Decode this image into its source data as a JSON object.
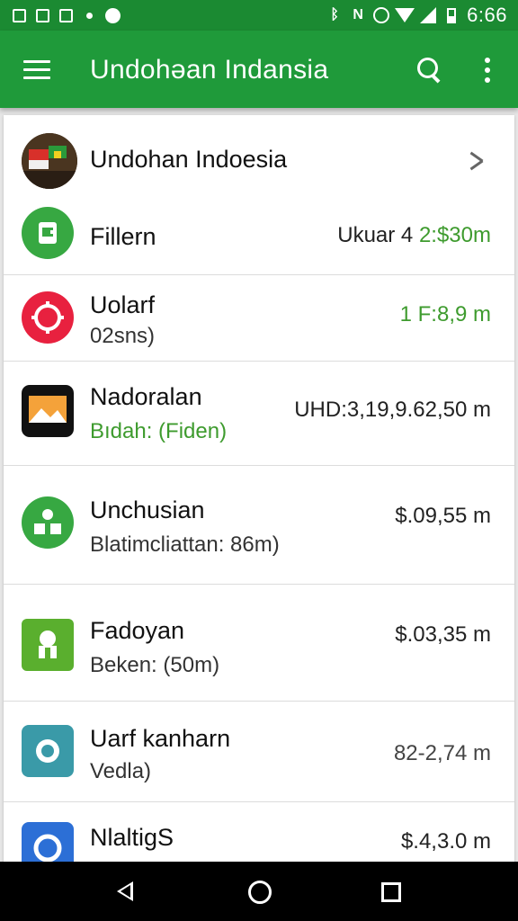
{
  "status_bar": {
    "time": "6:66",
    "icons": [
      "sim-icon",
      "sim-icon",
      "notification-icon",
      "dot-icon",
      "alarm-icon",
      "bluetooth-icon",
      "nfc-icon",
      "alarm-clock-icon",
      "wifi-icon",
      "signal-icon",
      "battery-icon"
    ]
  },
  "app_bar": {
    "title": "Undohəan Indansia",
    "icons": [
      "menu-icon",
      "search-icon",
      "more-vert-icon"
    ]
  },
  "header": {
    "title": "Undohan Indoesia",
    "icon": "flag-avatar-icon",
    "chevron": "chevron-right-icon"
  },
  "accounts": [
    {
      "name": "Fillern",
      "subtitle": "",
      "amount_prefix": "Ukuar 4 ",
      "amount": "2:$30m",
      "icon": "bank-icon",
      "icon_color": "#37a842",
      "amount_color": "#3e9b2e"
    },
    {
      "name": "Uolarf",
      "subtitle": "02sns)",
      "amount_prefix": "",
      "amount": "1 F:8,9 m",
      "icon": "gear-icon",
      "icon_color": "#e8213f",
      "amount_color": "#3e9b2e"
    },
    {
      "name": "Nadoralan",
      "subtitle": "Bıdah: (Fiden)",
      "amount_prefix": "",
      "amount": "UHD:3,19,9.62,50 m",
      "icon": "photo-icon",
      "icon_color": "#111111",
      "amount_color": "#222222"
    },
    {
      "name": "Unchusian",
      "subtitle": "Blatimcliattan:  86m)",
      "amount_prefix": "",
      "amount": "$.09,55 m",
      "icon": "people-icon",
      "icon_color": "#37a842",
      "amount_color": "#222222"
    },
    {
      "name": "Fadoyan",
      "subtitle": "Beken: (50m)",
      "amount_prefix": "",
      "amount": "$.03,35 m",
      "icon": "person-icon",
      "icon_color": "#5aaf2e",
      "amount_color": "#222222"
    },
    {
      "name": "Uarf kanharn",
      "subtitle": "Vedla)",
      "amount_prefix": "",
      "amount": "82-2,74 m",
      "icon": "camera-icon",
      "icon_color": "#3a9aa8",
      "amount_color": "#444444"
    },
    {
      "name": "NlaltigS",
      "subtitle": "",
      "amount_prefix": "",
      "amount": "$.4,3.0 m",
      "icon": "circle-icon",
      "icon_color": "#2c6fd6",
      "amount_color": "#222222"
    }
  ],
  "nav_bar": {
    "icons": [
      "back-icon",
      "home-icon",
      "recents-icon"
    ]
  }
}
